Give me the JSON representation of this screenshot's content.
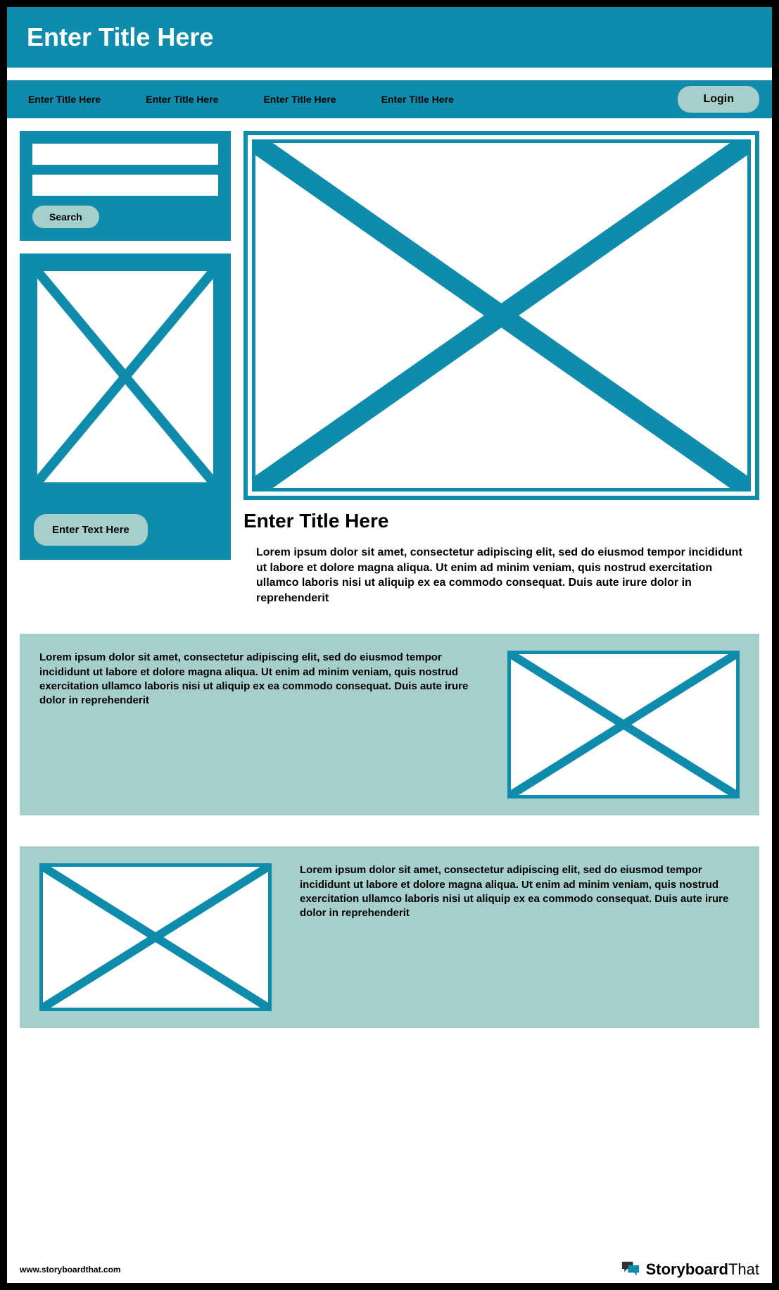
{
  "header": {
    "title": "Enter Title Here"
  },
  "nav": {
    "items": [
      "Enter Title Here",
      "Enter Title Here",
      "Enter Title Here",
      "Enter Title Here"
    ],
    "login_label": "Login"
  },
  "search": {
    "btn_label": "Search"
  },
  "promo": {
    "btn_label": "Enter Text Here"
  },
  "hero": {
    "title": "Enter Title Here",
    "text": "Lorem ipsum dolor sit amet, consectetur adipiscing elit, sed do eiusmod tempor incididunt ut labore et dolore magna aliqua. Ut enim ad minim veniam, quis nostrud exercitation ullamco laboris nisi ut aliquip ex ea commodo consequat. Duis aute irure dolor in reprehenderit"
  },
  "band1": {
    "text": "Lorem ipsum dolor sit amet, consectetur adipiscing elit, sed do eiusmod tempor incididunt ut labore et dolore magna aliqua. Ut enim ad minim veniam, quis nostrud exercitation ullamco laboris nisi ut aliquip ex ea commodo consequat. Duis aute irure dolor in reprehenderit"
  },
  "band2": {
    "text": "Lorem ipsum dolor sit amet, consectetur adipiscing elit, sed do eiusmod tempor incididunt ut labore et dolore magna aliqua. Ut enim ad minim veniam, quis nostrud exercitation ullamco laboris nisi ut aliquip ex ea commodo consequat. Duis aute irure dolor in reprehenderit"
  },
  "footer": {
    "url": "www.storyboardthat.com",
    "brand1": "Storyboard",
    "brand2": "That"
  }
}
